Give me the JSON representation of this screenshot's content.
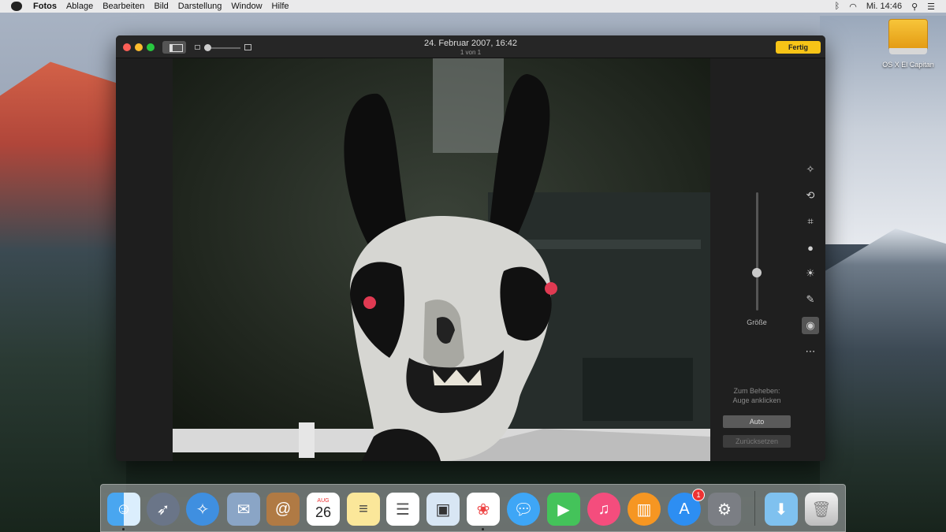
{
  "menubar": {
    "app": "Fotos",
    "menus": [
      "Ablage",
      "Bearbeiten",
      "Bild",
      "Darstellung",
      "Window",
      "Hilfe"
    ],
    "clock": "Mi. 14:46"
  },
  "desktop": {
    "drive_label": "OS X El Capitan"
  },
  "window": {
    "title": "24. Februar 2007, 16:42",
    "subtitle": "1 von 1",
    "done_label": "Fertig"
  },
  "panel": {
    "slider_label": "Größe",
    "slider_value": 0.32,
    "hint_line1": "Zum Beheben:",
    "hint_line2": "Auge anklicken",
    "auto_label": "Auto",
    "reset_label": "Zurücksetzen"
  },
  "dock": {
    "calendar_month": "AUG",
    "calendar_day": "26",
    "app_store_badge": "1"
  },
  "colors": {
    "accent_yellow": "#f7c417",
    "window_bg": "#1e1e1e"
  }
}
